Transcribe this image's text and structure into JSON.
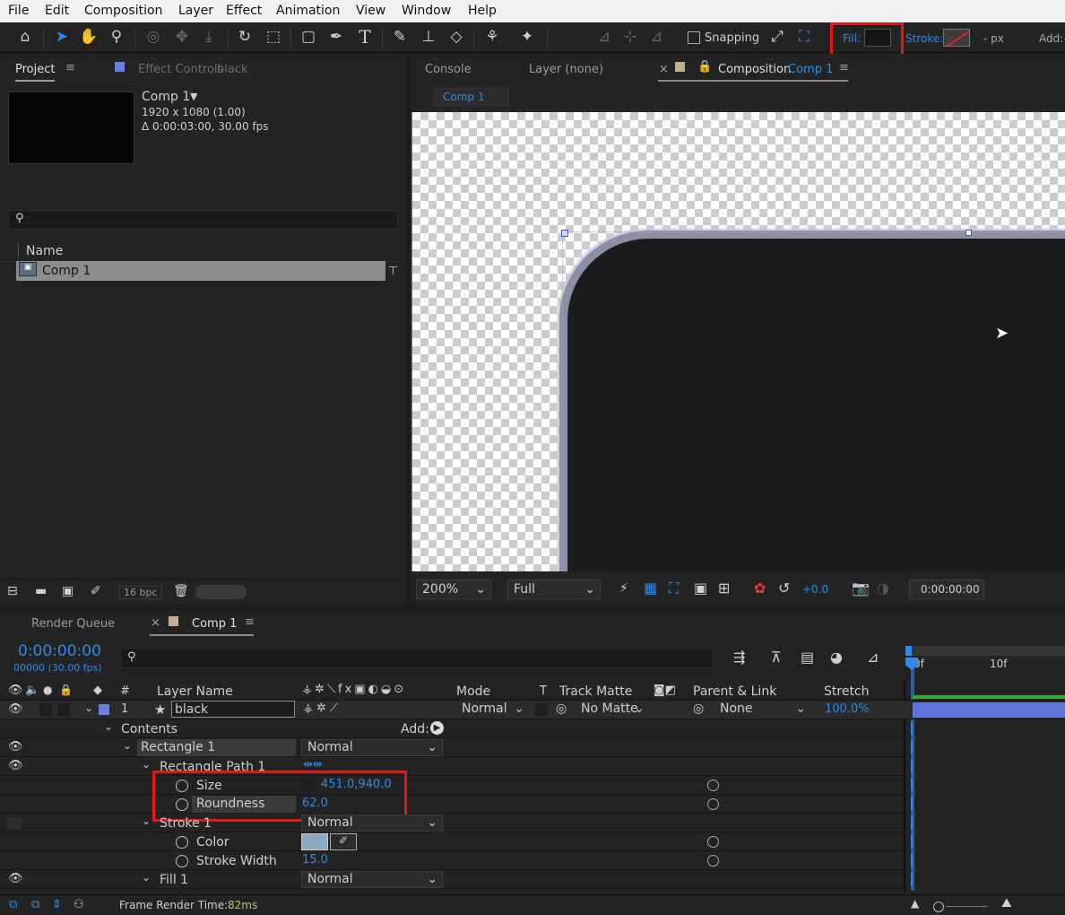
{
  "menu": [
    "File",
    "Edit",
    "Composition",
    "Layer",
    "Effect",
    "Animation",
    "View",
    "Window",
    "Help"
  ],
  "toolbar": {
    "snapping": "Snapping",
    "fill": "Fill:",
    "stroke": "Stroke:",
    "px": "- px",
    "add": "Add:"
  },
  "project": {
    "tab": "Project",
    "effect_tab": "Effect Controls",
    "effect_layer": "black",
    "comp_name": "Comp 1",
    "dims": "1920 x 1080 (1.00)",
    "duration": "Δ 0:00:03:00, 30.00 fps",
    "col_name": "Name",
    "item": "Comp 1",
    "bpc": "16 bpc"
  },
  "viewer": {
    "console": "Console",
    "layer_tab": "Layer (none)",
    "comp_tab": "Composition",
    "comp_link": "Comp 1",
    "flow_tab": "Comp 1",
    "zoom": "200%",
    "res": "Full",
    "exposure": "+0.0",
    "timecode": "0:00:00:00"
  },
  "timeline": {
    "render_queue": "Render Queue",
    "comp_tab": "Comp 1",
    "timecode": "0:00:00:00",
    "frames": "00000 (30.00 fps)",
    "ruler0": "0f",
    "ruler1": "10f",
    "headers": {
      "num": "#",
      "layer_name": "Layer Name",
      "mode": "Mode",
      "t": "T",
      "track_matte": "Track Matte",
      "parent": "Parent & Link",
      "stretch": "Stretch"
    },
    "layer": {
      "num": "1",
      "name": "black",
      "mode": "Normal",
      "matte": "No Matte",
      "parent": "None",
      "stretch": "100.0%"
    },
    "contents": "Contents",
    "add": "Add:",
    "rect": "Rectangle 1",
    "rect_mode": "Normal",
    "rect_path": "Rectangle Path 1",
    "size_label": "Size",
    "size_val": "451.0,940.0",
    "round_label": "Roundness",
    "round_val": "62.0",
    "stroke": "Stroke 1",
    "stroke_mode": "Normal",
    "color_label": "Color",
    "width_label": "Stroke Width",
    "width_val": "15.0",
    "fill": "Fill 1",
    "fill_mode": "Normal",
    "render_time_label": "Frame Render Time:",
    "render_time": "82ms"
  }
}
